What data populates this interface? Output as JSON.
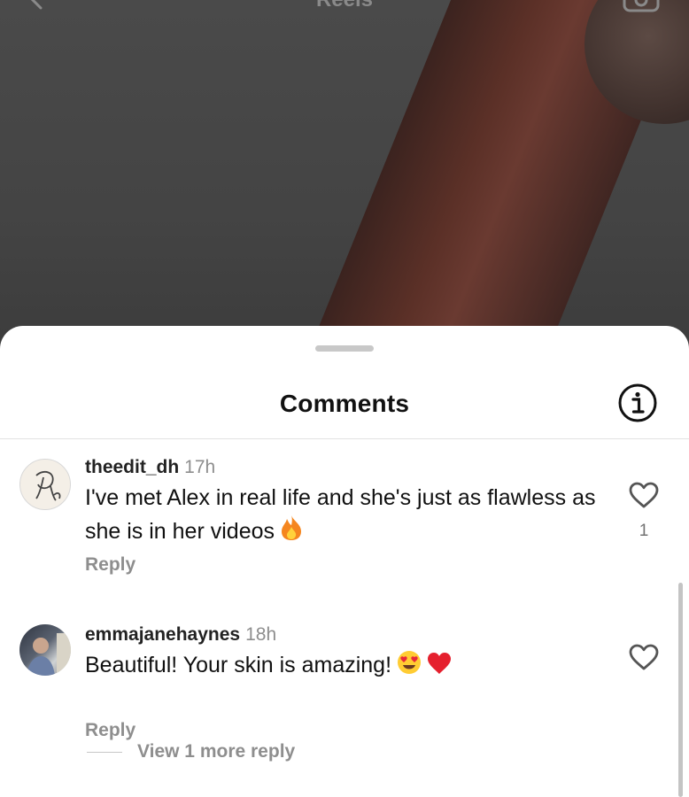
{
  "header": {
    "title": "Reels"
  },
  "sheet": {
    "title": "Comments"
  },
  "comments": [
    {
      "username": "theedit_dh",
      "time": "17h",
      "text": "I've met Alex in real life and she's just as flawless as she is in her videos",
      "emoji": [
        "fire"
      ],
      "reply_label": "Reply",
      "likes": "1"
    },
    {
      "username": "emmajanehaynes",
      "time": "18h",
      "text": "Beautiful! Your skin is amazing!",
      "emoji": [
        "heart-eyes",
        "red-heart"
      ],
      "reply_label": "Reply",
      "view_replies_label": "View 1 more reply"
    }
  ],
  "colors": {
    "sheet_bg": "#ffffff",
    "muted": "#8e8e8e",
    "text": "#111111"
  }
}
